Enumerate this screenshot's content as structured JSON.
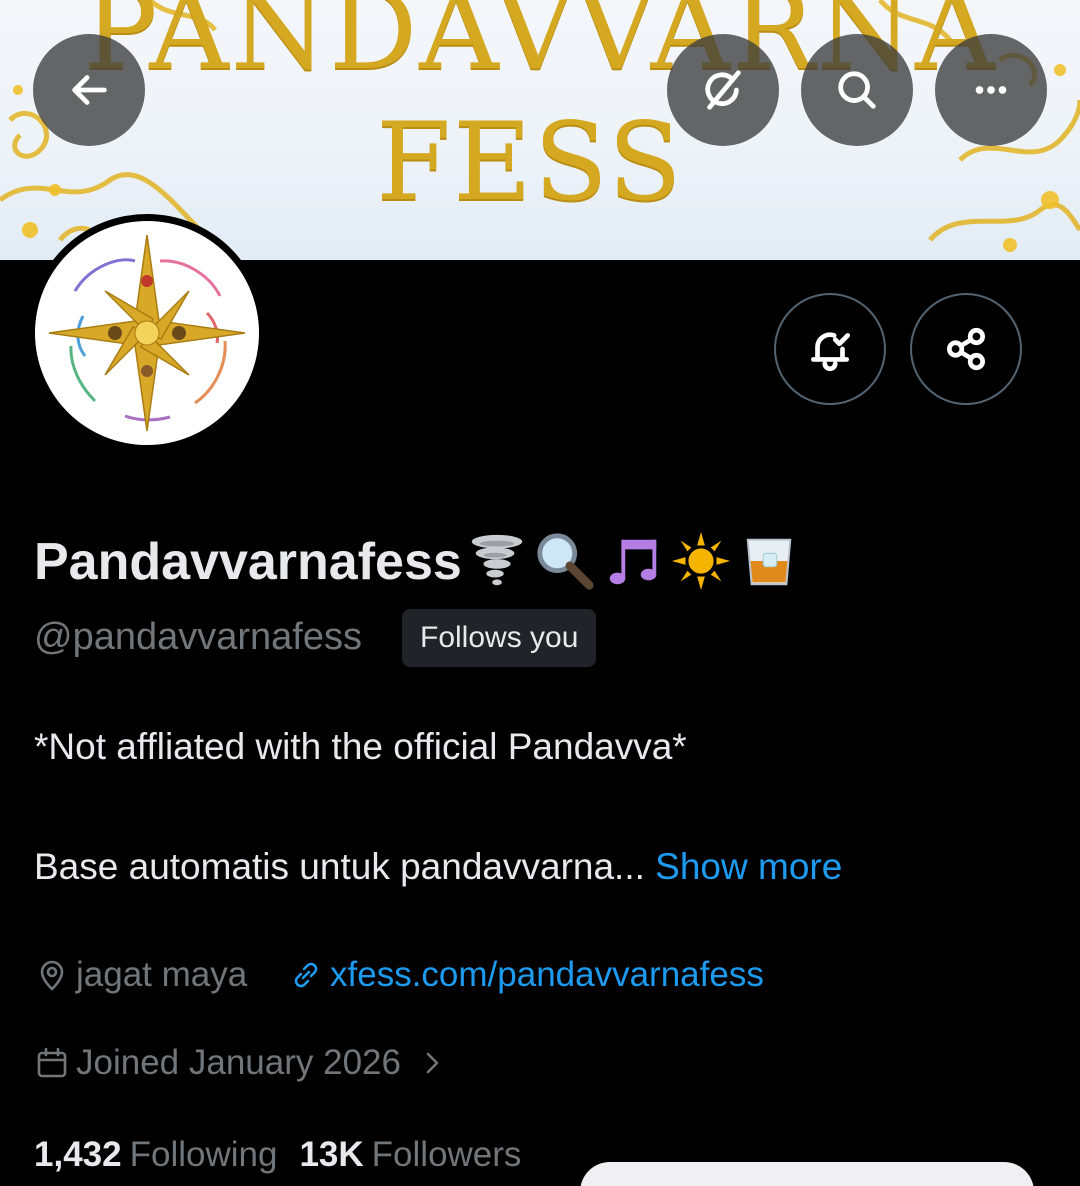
{
  "banner": {
    "title_line1": "PANDAVVARNA",
    "title_line2": "FESS",
    "colors": {
      "gold": "#d4a820",
      "sky": "#e8f0f7"
    }
  },
  "top_bar": {
    "back_icon": "arrow-left-icon",
    "grok_icon": "grok-icon",
    "search_icon": "search-icon",
    "more_icon": "more-horizontal-icon"
  },
  "actions": {
    "notify_icon": "bell-check-icon",
    "share_icon": "share-icon"
  },
  "profile": {
    "display_name": "Pandavvarnafess",
    "emojis": [
      "tornado",
      "magnifier",
      "music-notes",
      "sun",
      "tumbler-glass"
    ],
    "handle": "@pandavvarnafess",
    "follows_you": "Follows you",
    "bio_line1": "*Not affliated with the official Pandavva*",
    "bio_line2": "Base automatis untuk pandavvarna...",
    "show_more": "Show more",
    "location": "jagat maya",
    "website": "xfess.com/pandavvarnafess",
    "joined": "Joined January 2026"
  },
  "stats": {
    "following_count": "1,432",
    "following_label": "Following",
    "followers_count": "13K",
    "followers_label": "Followers"
  },
  "colors": {
    "background": "#000000",
    "text": "#e7e9ea",
    "muted": "#71767b",
    "link": "#1d9bf0"
  }
}
